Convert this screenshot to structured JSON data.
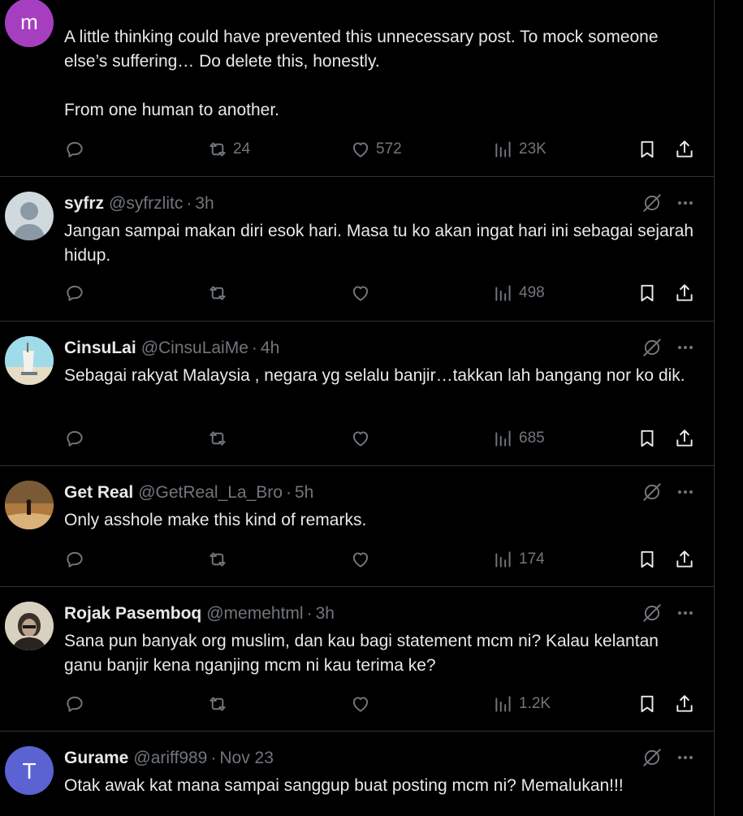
{
  "colors": {
    "background": "#000000",
    "text": "#e7e9ea",
    "muted": "#71767b",
    "divider": "#2f3336"
  },
  "tweets": [
    {
      "avatar": {
        "letter": "m",
        "color": "#a63fbf"
      },
      "body": "A little thinking could have prevented this unnecessary post. To mock someone else’s suffering… Do delete this, honestly.\n\nFrom one human to another.",
      "stats": {
        "replies": "",
        "retweets": "24",
        "likes": "572",
        "views": "23K"
      }
    },
    {
      "name": "syfrz",
      "handle": "@syfrzlitc",
      "time": "3h",
      "avatar": {
        "letter": "",
        "color": "#cfd9de"
      },
      "body": "Jangan sampai makan diri esok hari. Masa tu ko akan ingat hari ini sebagai sejarah hidup.",
      "stats": {
        "replies": "",
        "retweets": "",
        "likes": "",
        "views": "498"
      }
    },
    {
      "name": "CinsuLai",
      "handle": "@CinsuLaiMe",
      "time": "4h",
      "avatar": {
        "letter": "",
        "color": "#8fd3e0"
      },
      "body": "Sebagai rakyat Malaysia , negara yg selalu banjir…takkan lah bangang nor ko dik.",
      "stats": {
        "replies": "",
        "retweets": "",
        "likes": "",
        "views": "685"
      }
    },
    {
      "name": "Get Real",
      "handle": "@GetReal_La_Bro",
      "time": "5h",
      "avatar": {
        "letter": "",
        "color": "#9a6a3a"
      },
      "body": "Only asshole make this kind of remarks.",
      "stats": {
        "replies": "",
        "retweets": "",
        "likes": "",
        "views": "174"
      }
    },
    {
      "name": "Rojak Pasemboq",
      "handle": "@memehtml",
      "time": "3h",
      "avatar": {
        "letter": "",
        "color": "#c9c2b2"
      },
      "body": "Sana pun banyak org muslim, dan kau bagi statement mcm ni? Kalau kelantan ganu banjir kena nganjing mcm ni kau terima ke?",
      "stats": {
        "replies": "",
        "retweets": "",
        "likes": "",
        "views": "1.2K"
      }
    },
    {
      "name": "Gurame",
      "handle": "@ariff989",
      "time": "Nov 23",
      "avatar": {
        "letter": "T",
        "color": "#5b63d3"
      },
      "body": "Otak awak kat mana sampai sanggup buat posting mcm ni? Memalukan!!!",
      "stats": {
        "replies": "",
        "retweets": "",
        "likes": "",
        "views": ""
      }
    }
  ]
}
